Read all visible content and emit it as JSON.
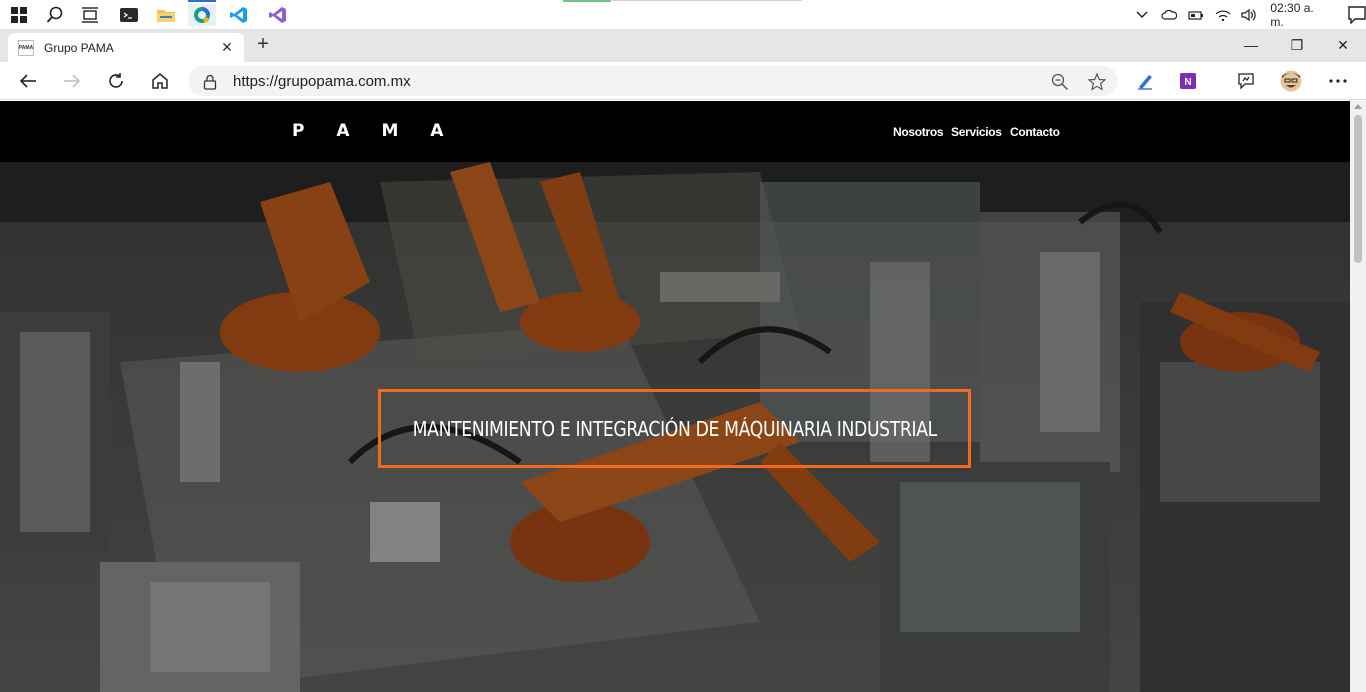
{
  "taskbar": {
    "icons": [
      "windows-start-icon",
      "search-icon",
      "task-view-icon",
      "terminal-icon",
      "file-explorer-icon",
      "edge-canary-icon",
      "vscode-icon",
      "visual-studio-icon"
    ],
    "clock": "02:30 a. m."
  },
  "browser": {
    "tab_title": "Grupo PAMA",
    "tab_favicon_text": "PAMA",
    "url": "https://grupopama.com.mx"
  },
  "site": {
    "logo": "P A M A",
    "nav": [
      "Nosotros",
      "Servicios",
      "Contacto"
    ],
    "headline": "MANTENIMIENTO E INTEGRACIÓN DE MÁQUINARIA INDUSTRIAL",
    "accent_color": "#f26a1b"
  }
}
